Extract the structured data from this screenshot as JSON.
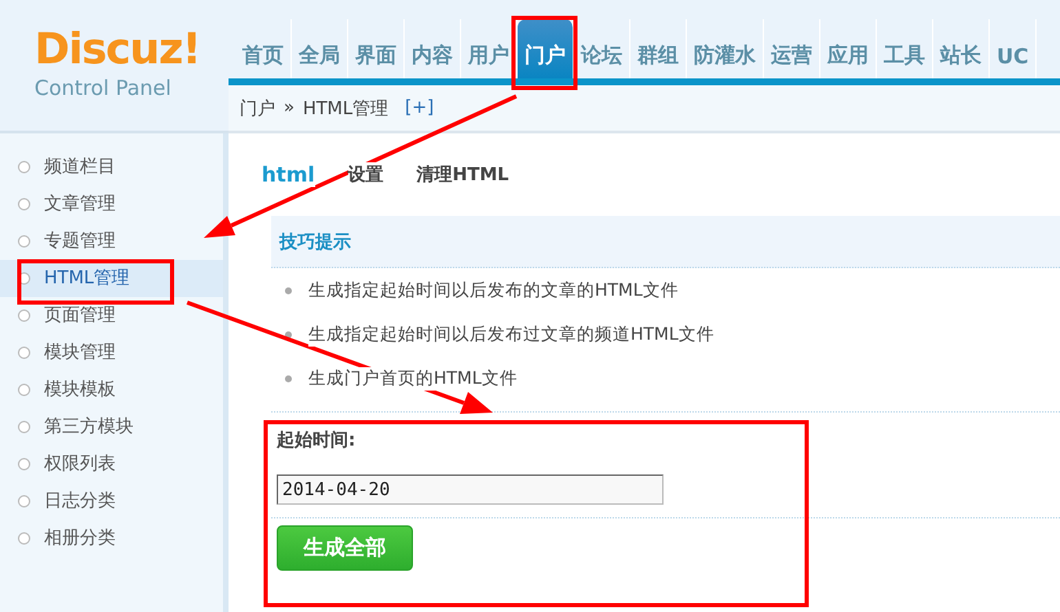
{
  "logo": {
    "title": "Discuz!",
    "subtitle": "Control Panel"
  },
  "nav": [
    {
      "label": "首页",
      "selected": false
    },
    {
      "label": "全局",
      "selected": false
    },
    {
      "label": "界面",
      "selected": false
    },
    {
      "label": "内容",
      "selected": false
    },
    {
      "label": "用户",
      "selected": false
    },
    {
      "label": "门户",
      "selected": true
    },
    {
      "label": "论坛",
      "selected": false
    },
    {
      "label": "群组",
      "selected": false
    },
    {
      "label": "防灌水",
      "selected": false
    },
    {
      "label": "运营",
      "selected": false
    },
    {
      "label": "应用",
      "selected": false
    },
    {
      "label": "工具",
      "selected": false
    },
    {
      "label": "站长",
      "selected": false
    },
    {
      "label": "UC",
      "selected": false
    }
  ],
  "breadcrumb": {
    "section": "门户",
    "separator": "»",
    "current": "HTML管理",
    "expand": "[+]"
  },
  "sidebar": {
    "items": [
      {
        "label": "频道栏目",
        "selected": false
      },
      {
        "label": "文章管理",
        "selected": false
      },
      {
        "label": "专题管理",
        "selected": false
      },
      {
        "label": "HTML管理",
        "selected": true
      },
      {
        "label": "页面管理",
        "selected": false
      },
      {
        "label": "模块管理",
        "selected": false
      },
      {
        "label": "模块模板",
        "selected": false
      },
      {
        "label": "第三方模块",
        "selected": false
      },
      {
        "label": "权限列表",
        "selected": false
      },
      {
        "label": "日志分类",
        "selected": false
      },
      {
        "label": "相册分类",
        "selected": false
      }
    ]
  },
  "tabs": [
    {
      "label": "html",
      "selected": true
    },
    {
      "label": "设置",
      "selected": false
    },
    {
      "label": "清理HTML",
      "selected": false
    }
  ],
  "tips": {
    "title": "技巧提示",
    "items": [
      "生成指定起始时间以后发布的文章的HTML文件",
      "生成指定起始时间以后发布过文章的频道HTML文件",
      "生成门户首页的HTML文件"
    ]
  },
  "form": {
    "label": "起始时间:",
    "value": "2014-04-20",
    "button": "生成全部"
  }
}
